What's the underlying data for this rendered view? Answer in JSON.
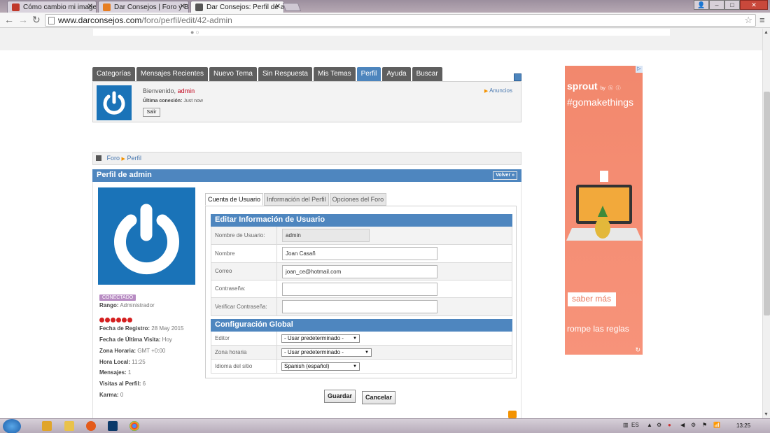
{
  "browser": {
    "tabs": [
      {
        "title": "Cómo cambio mi imagen",
        "favicon_color": "#c0392b"
      },
      {
        "title": "Dar Consejos | Foro y Blog",
        "favicon_color": "#e67e22"
      },
      {
        "title": "Dar Consejos: Perfil de ad",
        "favicon_color": "#555555"
      }
    ],
    "url_domain": "www.darconsejos.com",
    "url_path": "/foro/perfil/edit/42-admin"
  },
  "forum": {
    "nav": [
      "Categorías",
      "Mensajes Recientes",
      "Nuevo Tema",
      "Sin Respuesta",
      "Mis Temas",
      "Perfil",
      "Ayuda",
      "Buscar"
    ],
    "active_nav": "Perfil",
    "welcome_label": "Bienvenido,",
    "username": "admin",
    "last_conn_label": "Última conexión:",
    "last_conn_value": "Just now",
    "logout": "Salir",
    "announcements": "Anuncios",
    "breadcrumb": {
      "root": "Foro",
      "current": "Perfil"
    },
    "profile_title": "Perfil de admin",
    "back": "Volver »"
  },
  "profile": {
    "status": "CONECTADO",
    "stats": [
      {
        "label": "Rango:",
        "value": "Administrador"
      },
      {
        "label": "Fecha de Registro:",
        "value": "28 May 2015"
      },
      {
        "label": "Fecha de Última Visita:",
        "value": "Hoy"
      },
      {
        "label": "Zona Horaria:",
        "value": "GMT +0:00"
      },
      {
        "label": "Hora Local:",
        "value": "11:25"
      },
      {
        "label": "Mensajes:",
        "value": "1"
      },
      {
        "label": "Visitas al Perfil:",
        "value": "6"
      },
      {
        "label": "Karma:",
        "value": "0"
      }
    ],
    "rank_stars": 6
  },
  "form": {
    "tabs": [
      "Cuenta de Usuario",
      "Información del Perfil",
      "Opciones del Foro"
    ],
    "section1": "Editar Información de Usuario",
    "username_label": "Nombre de Usuario:",
    "username_value": "admin",
    "name_label": "Nombre",
    "name_value": "Joan Casañ",
    "email_label": "Correo",
    "email_value": "joan_ce@hotmail.com",
    "password_label": "Contraseña:",
    "verify_label": "Verificar Contraseña:",
    "section2": "Configuración Global",
    "editor_label": "Editor",
    "editor_value": "- Usar predeterminado -",
    "tz_label": "Zona horaria",
    "tz_value": "- Usar predeterminado -",
    "lang_label": "Idioma del sitio",
    "lang_value": "Spanish (español)",
    "save": "Guardar",
    "cancel": "Cancelar"
  },
  "ad": {
    "brand": "sprout",
    "brand_by": "by",
    "tagline": "#gomakethings",
    "cta": "saber más",
    "claim": "rompe las reglas"
  },
  "taskbar": {
    "lang": "ES",
    "clock": "13:25"
  },
  "colors": {
    "forum_blue": "#4e86bf",
    "nav_grey": "#5f5f5f",
    "ad_orange": "#f58a70",
    "username_red": "#c2001a"
  }
}
